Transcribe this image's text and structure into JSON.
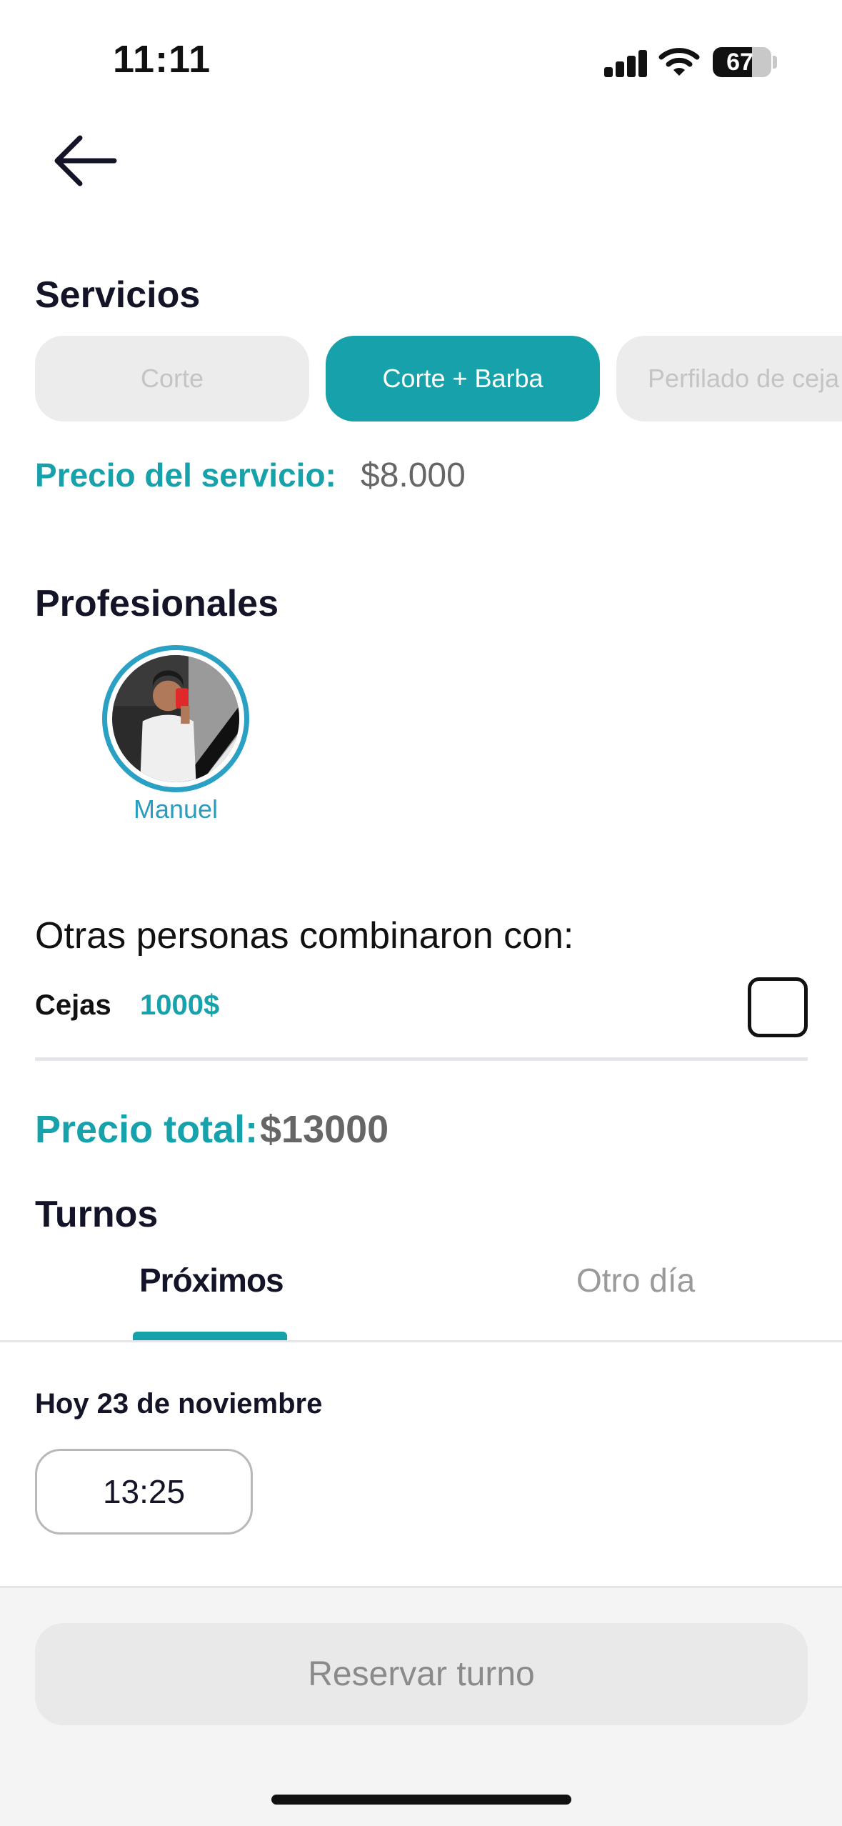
{
  "status_bar": {
    "time": "11:11",
    "battery_level": "67",
    "battery_percent": 67
  },
  "header": {
    "back_icon": "arrow-left-icon"
  },
  "services": {
    "title": "Servicios",
    "items": [
      {
        "label": "Corte",
        "selected": false
      },
      {
        "label": "Corte + Barba",
        "selected": true
      },
      {
        "label": "Perfilado de ceja",
        "selected": false
      }
    ],
    "price_label": "Precio del servicio:",
    "price_value": "$8.000"
  },
  "professionals": {
    "title": "Profesionales",
    "items": [
      {
        "name": "Manuel",
        "avatar": "avatar-photo"
      }
    ]
  },
  "combos": {
    "title": "Otras personas combinaron con:",
    "items": [
      {
        "name": "Cejas",
        "price": "1000$",
        "checked": false
      }
    ]
  },
  "total": {
    "label": "Precio total:",
    "value": "$13000"
  },
  "turnos": {
    "title": "Turnos",
    "tabs": [
      {
        "label": "Próximos",
        "active": true
      },
      {
        "label": "Otro día",
        "active": false
      }
    ],
    "date_label": "Hoy 23 de noviembre",
    "slots": [
      "13:25"
    ]
  },
  "footer": {
    "reserve_label": "Reservar turno"
  },
  "colors": {
    "accent": "#17a2ab",
    "avatar_ring": "#2aa1c4",
    "text_dark": "#141428"
  }
}
